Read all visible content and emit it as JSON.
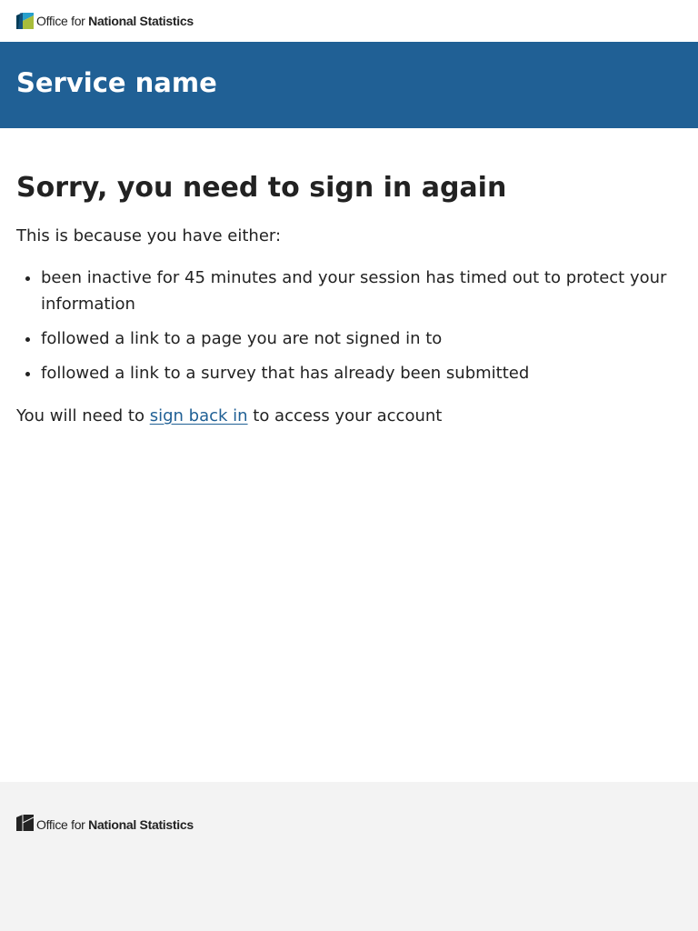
{
  "header": {
    "logo_text_light": "Office for",
    "logo_text_bold": "National Statistics",
    "logo_icon": "ons-logo-icon",
    "logo_colors": [
      "#003c57",
      "#a8bd3a",
      "#27a0cc",
      "#206095"
    ]
  },
  "service": {
    "name": "Service name",
    "bar_color": "#206095"
  },
  "main": {
    "heading": "Sorry, you need to sign in again",
    "intro": "This is because you have either:",
    "reasons": [
      "been inactive for 45 minutes and your session has timed out to protect your information",
      "followed a link to a page you are not signed in to",
      "followed a link to a survey that has already been submitted"
    ],
    "outro_before": "You will need to ",
    "outro_link": "sign back in",
    "outro_after": " to access your account",
    "link_color": "#206095"
  },
  "footer": {
    "logo_text_light": "Office for",
    "logo_text_bold": "National Statistics",
    "logo_icon": "ons-logo-icon-mono",
    "background": "#f3f3f3"
  }
}
